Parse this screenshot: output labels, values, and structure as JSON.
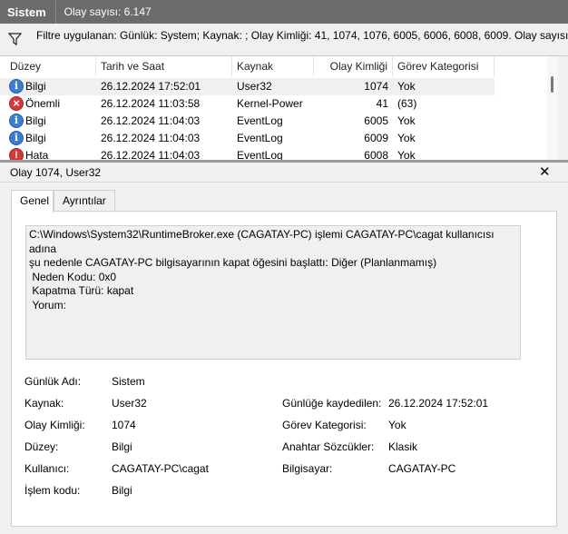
{
  "window": {
    "title": "Sistem",
    "event_count": "Olay sayısı: 6.147"
  },
  "filter": {
    "text": "Filtre uygulanan: Günlük: System; Kaynak: ; Olay Kimliği: 41, 1074, 1076, 6005, 6006, 6008, 6009. Olay sayısı:"
  },
  "events": {
    "columns": [
      "Düzey",
      "Tarih ve Saat",
      "Kaynak",
      "Olay Kimliği",
      "Görev Kategorisi"
    ],
    "rows": [
      {
        "level": "Bilgi",
        "icon": "info-icon",
        "datetime": "26.12.2024 17:52:01",
        "source": "User32",
        "id": "1074",
        "category": "Yok"
      },
      {
        "level": "Önemli",
        "icon": "critical-icon",
        "datetime": "26.12.2024 11:03:58",
        "source": "Kernel-Power",
        "id": "41",
        "category": "(63)"
      },
      {
        "level": "Bilgi",
        "icon": "info-icon",
        "datetime": "26.12.2024 11:04:03",
        "source": "EventLog",
        "id": "6005",
        "category": "Yok"
      },
      {
        "level": "Bilgi",
        "icon": "info-icon",
        "datetime": "26.12.2024 11:04:03",
        "source": "EventLog",
        "id": "6009",
        "category": "Yok"
      },
      {
        "level": "Hata",
        "icon": "error-icon",
        "datetime": "26.12.2024 11:04:03",
        "source": "EventLog",
        "id": "6008",
        "category": "Yok"
      }
    ]
  },
  "detail": {
    "title": "Olay 1074, User32",
    "tabs": [
      "Genel",
      "Ayrıntılar"
    ],
    "message": "C:\\Windows\\System32\\RuntimeBroker.exe (CAGATAY-PC) işlemi CAGATAY-PC\\cagat kullanıcısı adına\nşu nedenle CAGATAY-PC bilgisayarının kapat öğesini başlattı: Diğer (Planlanmamış)\n Neden Kodu: 0x0\n Kapatma Türü: kapat\n Yorum: ",
    "fields": {
      "log_name_label": "Günlük Adı:",
      "log_name": "Sistem",
      "source_label": "Kaynak:",
      "source": "User32",
      "logged_label": "Günlüğe kaydedilen:",
      "logged": "26.12.2024 17:52:01",
      "event_id_label": "Olay Kimliği:",
      "event_id": "1074",
      "task_label": "Görev Kategorisi:",
      "task": "Yok",
      "level_label": "Düzey:",
      "level": "Bilgi",
      "keywords_label": "Anahtar Sözcükler:",
      "keywords": "Klasik",
      "user_label": "Kullanıcı:",
      "user": "CAGATAY-PC\\cagat",
      "computer_label": "Bilgisayar:",
      "computer": "CAGATAY-PC",
      "opcode_label": "İşlem kodu:",
      "opcode": "Bilgi"
    }
  }
}
